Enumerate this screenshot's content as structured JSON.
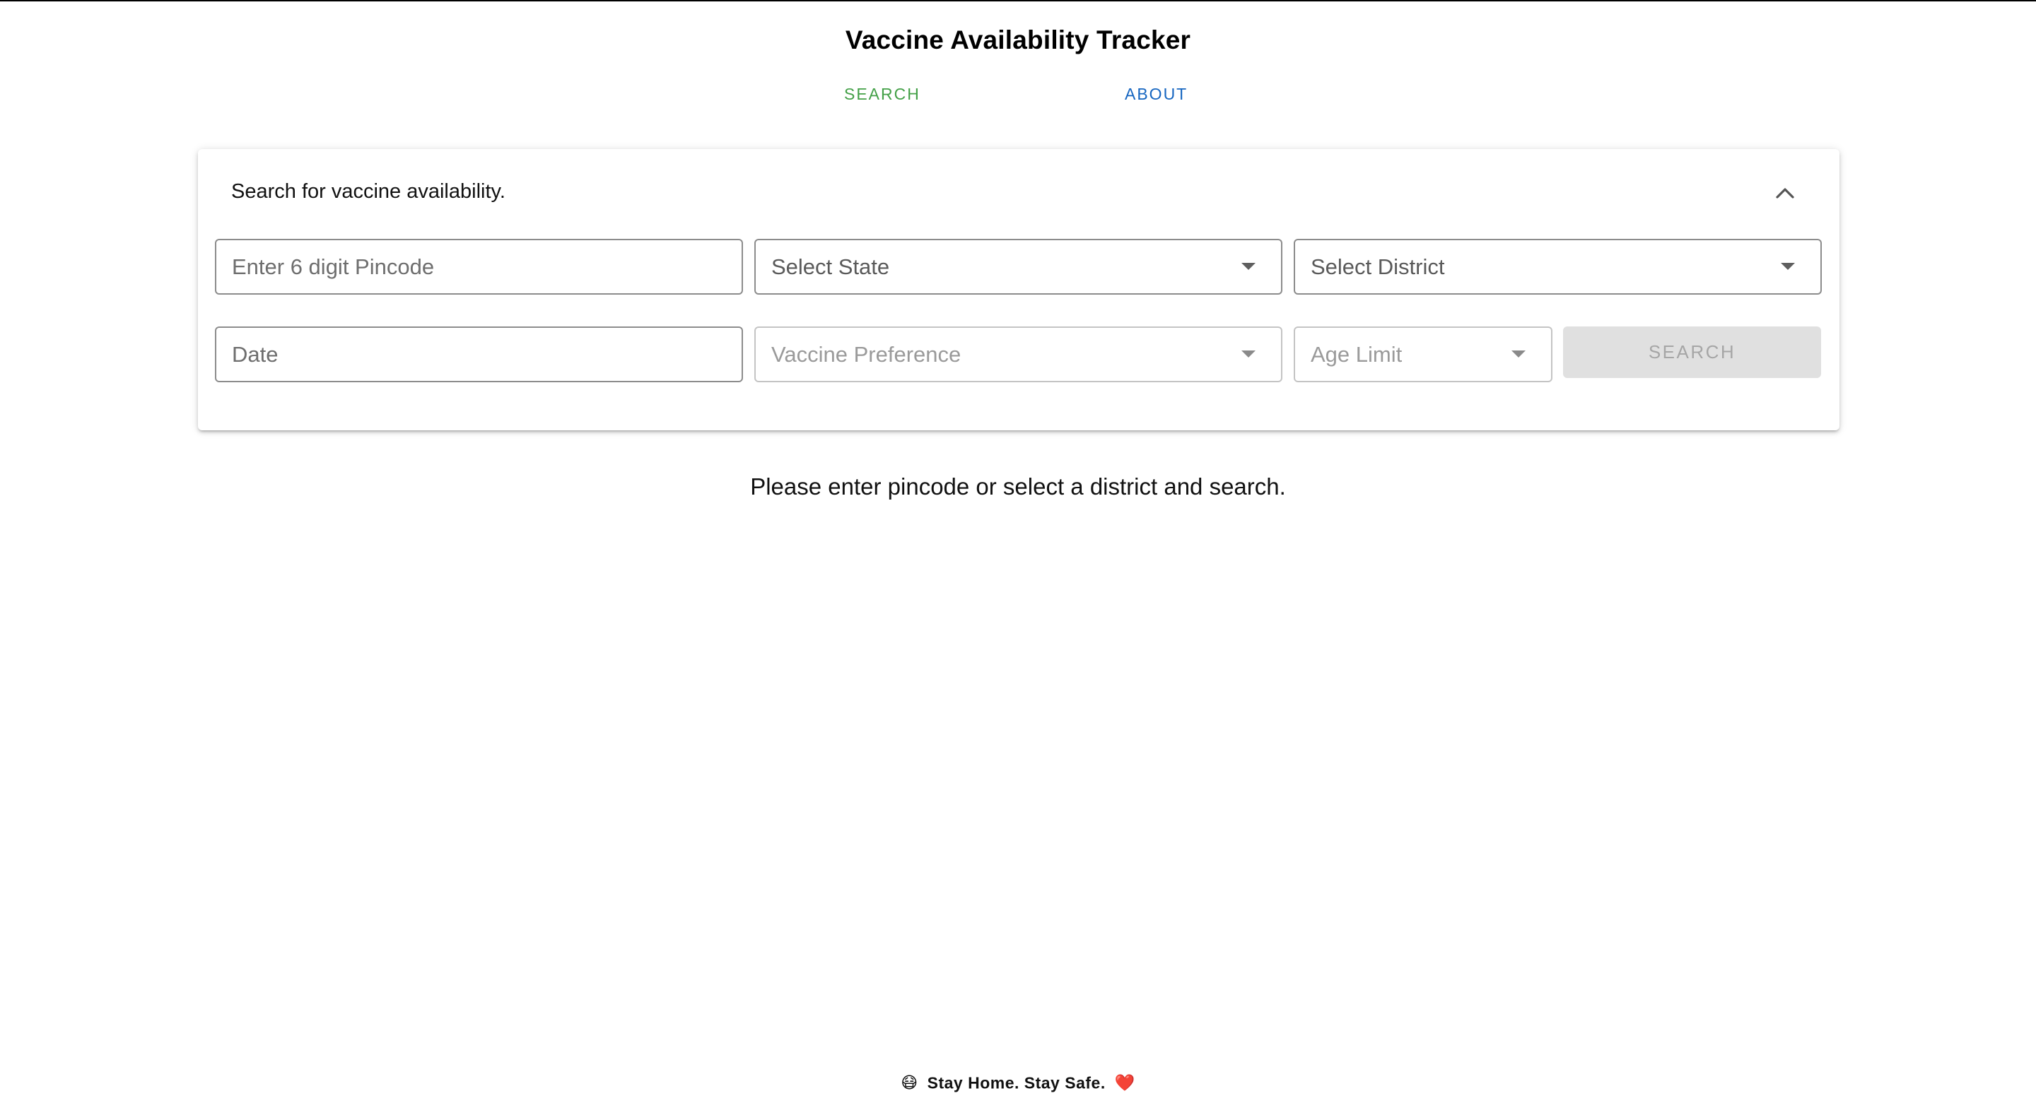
{
  "app": {
    "title": "Vaccine Availability Tracker"
  },
  "nav": {
    "tabs": [
      {
        "label": "SEARCH",
        "color": "#43a047",
        "active": true
      },
      {
        "label": "ABOUT",
        "color": "#1565c0",
        "active": false
      }
    ]
  },
  "search_panel": {
    "summary": "Search for vaccine availability.",
    "expanded": true,
    "collapse_icon": "chevron-up-icon",
    "pincode": {
      "placeholder": "Enter 6 digit Pincode",
      "value": ""
    },
    "state": {
      "placeholder": "Select State",
      "value": ""
    },
    "district": {
      "placeholder": "Select District",
      "value": ""
    },
    "date": {
      "placeholder": "Date",
      "value": ""
    },
    "vaccine": {
      "placeholder": "Vaccine Preference",
      "disabled": true
    },
    "age_limit": {
      "placeholder": "Age Limit",
      "disabled": true
    },
    "search_button": {
      "label": "SEARCH",
      "disabled": true
    }
  },
  "results": {
    "message": "Please enter pincode or select a district and search."
  },
  "footer": {
    "emoji_left": "😷",
    "text": "Stay Home. Stay Safe.",
    "emoji_right": "❤️"
  },
  "colors": {
    "accent_green": "#43a047",
    "accent_blue": "#1565c0",
    "disabled_bg": "#e0e0e0"
  }
}
